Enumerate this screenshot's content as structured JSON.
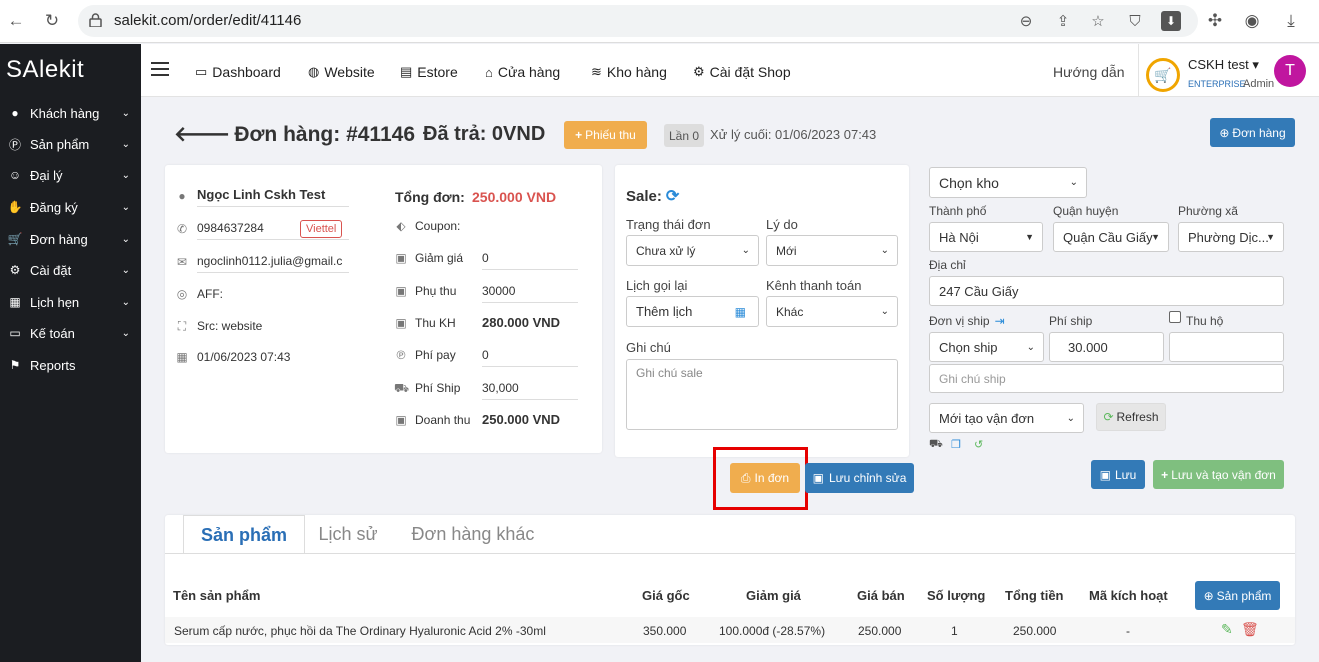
{
  "browser": {
    "url": "salekit.com/order/edit/41146"
  },
  "sidebar": {
    "logo": "SAlekit",
    "items": [
      {
        "label": "Khách hàng",
        "icon": "user-icon"
      },
      {
        "label": "Sản phẩm",
        "icon": "product-icon"
      },
      {
        "label": "Đại lý",
        "icon": "agent-icon"
      },
      {
        "label": "Đăng ký",
        "icon": "handshake-icon"
      },
      {
        "label": "Đơn hàng",
        "icon": "cart-icon"
      },
      {
        "label": "Cài đặt",
        "icon": "gear-icon"
      },
      {
        "label": "Lịch hẹn",
        "icon": "calendar-icon"
      },
      {
        "label": "Kế toán",
        "icon": "wallet-icon"
      },
      {
        "label": "Reports",
        "icon": "flag-icon"
      }
    ]
  },
  "topnav": {
    "items": [
      "Dashboard",
      "Website",
      "Estore",
      "Cửa hàng",
      "Kho hàng",
      "Cài đặt Shop"
    ],
    "help": "Hướng dẫn",
    "user_name": "CSKH test",
    "plan": "ENTERPRISE",
    "role": "Admin",
    "avatar_letter": "T"
  },
  "header": {
    "title": "Đơn hàng: #41146",
    "paid": "Đã trả: 0VND",
    "receipt_btn": "Phiếu thu",
    "times": "Lần 0",
    "last_processed": "Xử lý cuối: 01/06/2023 07:43",
    "order_btn": "Đơn hàng"
  },
  "customer": {
    "name": "Ngọc Linh Cskh Test",
    "phone": "0984637284",
    "carrier": "Viettel",
    "email": "ngoclinh0112.julia@gmail.c",
    "aff": "AFF:",
    "src": "Src: website",
    "date": "01/06/2023 07:43"
  },
  "totals": {
    "total_label": "Tổng đơn:",
    "total_value": "250.000 VND",
    "coupon_label": "Coupon:",
    "discount_label": "Giảm giá",
    "discount_value": "0",
    "surcharge_label": "Phụ thu",
    "surcharge_value": "30000",
    "collect_label": "Thu KH",
    "collect_value": "280.000 VND",
    "payfee_label": "Phí pay",
    "payfee_value": "0",
    "shipfee_label": "Phí Ship",
    "shipfee_value": "30,000",
    "revenue_label": "Doanh thu",
    "revenue_value": "250.000 VND"
  },
  "sale": {
    "title": "Sale:",
    "status_label": "Trạng thái đơn",
    "status_value": "Chưa xử lý",
    "reason_label": "Lý do",
    "reason_value": "Mới",
    "callback_label": "Lịch gọi lại",
    "callback_value": "Thêm lịch",
    "payment_label": "Kênh thanh toán",
    "payment_value": "Khác",
    "note_label": "Ghi chú",
    "note_placeholder": "Ghi chú sale"
  },
  "actions": {
    "print": "In đơn",
    "save_edit": "Lưu chỉnh sửa"
  },
  "shipping": {
    "warehouse": "Chọn kho",
    "city_label": "Thành phố",
    "city_value": "Hà Nội",
    "district_label": "Quận huyện",
    "district_value": "Quận Cầu Giấy",
    "ward_label": "Phường xã",
    "ward_value": "Phường Dịc...",
    "address_label": "Địa chỉ",
    "address_value": "247 Cầu Giấy",
    "carrier_label": "Đơn vị ship",
    "fee_label": "Phí ship",
    "cod_label": "Thu hộ",
    "carrier_value": "Chọn ship",
    "fee_value": "30.000",
    "ship_note_placeholder": "Ghi chú ship",
    "waybill_value": "Mới tạo vận đơn",
    "refresh": "Refresh",
    "save": "Lưu",
    "save_create": "Lưu và tạo vận đơn"
  },
  "tabs": [
    "Sản phẩm",
    "Lịch sử",
    "Đơn hàng khác"
  ],
  "table": {
    "headers": [
      "Tên sản phẩm",
      "Giá gốc",
      "Giảm giá",
      "Giá bán",
      "Số lượng",
      "Tổng tiền",
      "Mã kích hoạt"
    ],
    "add_btn": "Sản phẩm",
    "rows": [
      [
        "Serum cấp nước, phục hồi da The Ordinary Hyaluronic Acid 2% -30ml",
        "350.000",
        "100.000đ (-28.57%)",
        "250.000",
        "1",
        "250.000",
        "-"
      ]
    ]
  },
  "colors": {
    "orange": "#f0ad4e",
    "blue": "#337ab7",
    "green": "#7fbf7f",
    "red_highlight": "#e60000",
    "avatar": "#c0169f",
    "total_red": "#d9534f"
  }
}
